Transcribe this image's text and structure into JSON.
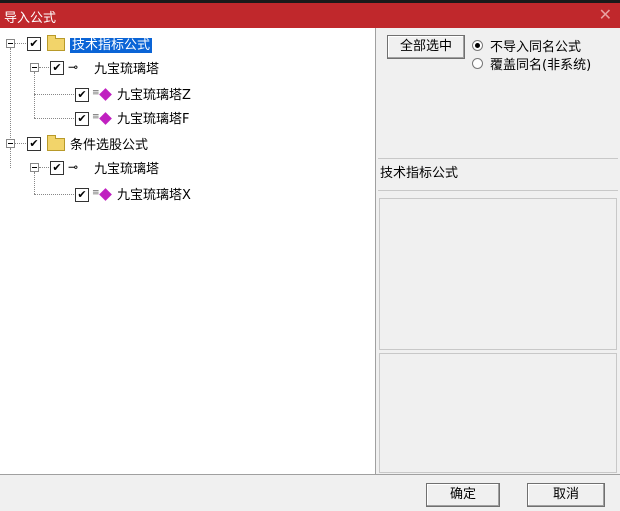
{
  "window": {
    "title": "导入公式",
    "close_glyph": "✕"
  },
  "tree": {
    "checkmark": "✔",
    "collapse_glyph": "−",
    "key_glyph": "⊸",
    "gem_prefix": "≡",
    "groups": [
      {
        "label": "技术指标公式",
        "selected": true,
        "item": {
          "label": "九宝琉璃塔",
          "children": [
            "九宝琉璃塔Z",
            "九宝琉璃塔F"
          ]
        }
      },
      {
        "label": "条件选股公式",
        "selected": false,
        "item": {
          "label": "九宝琉璃塔",
          "children": [
            "九宝琉璃塔X"
          ]
        }
      }
    ]
  },
  "options": {
    "select_all_label": "全部选中",
    "radio_no_import": "不导入同名公式",
    "radio_overwrite": "覆盖同名(非系统)",
    "selected_radio": "no_import"
  },
  "info": {
    "category_text": "技术指标公式"
  },
  "buttons": {
    "ok": "确定",
    "cancel": "取消"
  }
}
